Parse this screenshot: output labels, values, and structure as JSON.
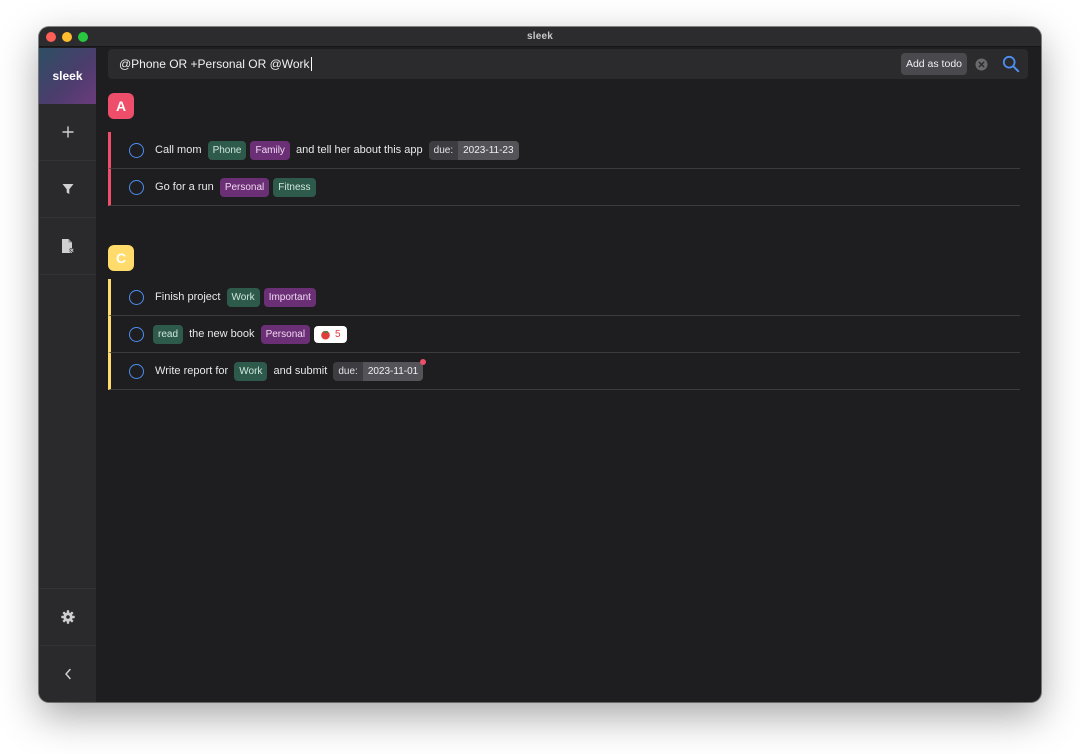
{
  "window": {
    "title": "sleek"
  },
  "sidebar": {
    "logo": "sleek",
    "items": [
      {
        "name": "add",
        "icon": "plus-icon"
      },
      {
        "name": "filter",
        "icon": "filter-icon"
      },
      {
        "name": "archive",
        "icon": "file-archive-icon"
      }
    ],
    "bottom": [
      {
        "name": "settings",
        "icon": "gear-icon"
      },
      {
        "name": "collapse",
        "icon": "chevron-left-icon"
      }
    ]
  },
  "search": {
    "value": "@Phone OR +Personal OR @Work",
    "add_label": "Add as todo"
  },
  "colors": {
    "priority_a": "#ef4e6a",
    "priority_c": "#fedb6a",
    "context_tag": "#2e5a4c",
    "project_tag": "#6b2f75",
    "checkbox": "#4d8ef0"
  },
  "groups": [
    {
      "priority": "A",
      "todos": [
        {
          "parts": [
            {
              "type": "text",
              "value": "Call mom"
            },
            {
              "type": "context",
              "value": "Phone"
            },
            {
              "type": "project",
              "value": "Family"
            },
            {
              "type": "text",
              "value": "and tell her about this app"
            },
            {
              "type": "due",
              "label": "due:",
              "value": "2023-11-23"
            }
          ]
        },
        {
          "parts": [
            {
              "type": "text",
              "value": "Go for a run"
            },
            {
              "type": "project",
              "value": "Personal"
            },
            {
              "type": "context",
              "value": "Fitness"
            }
          ]
        }
      ]
    },
    {
      "priority": "C",
      "todos": [
        {
          "parts": [
            {
              "type": "text",
              "value": "Finish project"
            },
            {
              "type": "context",
              "value": "Work"
            },
            {
              "type": "project",
              "value": "Important"
            }
          ]
        },
        {
          "parts": [
            {
              "type": "context",
              "value": "read"
            },
            {
              "type": "text",
              "value": "the new book"
            },
            {
              "type": "project",
              "value": "Personal"
            },
            {
              "type": "pomodoro",
              "value": "5"
            }
          ]
        },
        {
          "parts": [
            {
              "type": "text",
              "value": "Write report for"
            },
            {
              "type": "context",
              "value": "Work"
            },
            {
              "type": "text",
              "value": "and submit"
            },
            {
              "type": "due",
              "label": "due:",
              "value": "2023-11-01",
              "overdue": true
            }
          ]
        }
      ]
    }
  ]
}
